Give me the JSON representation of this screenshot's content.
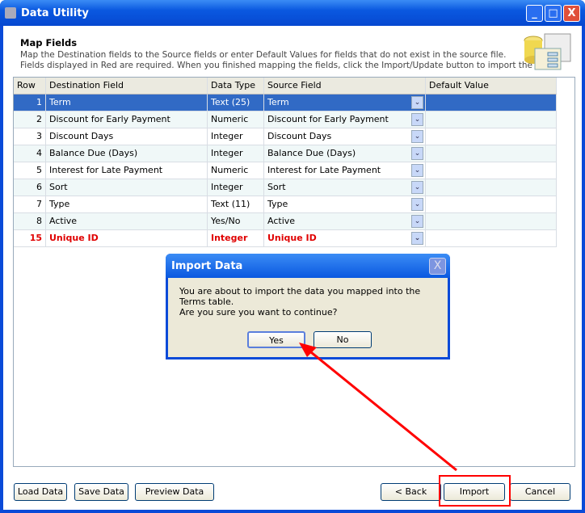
{
  "window": {
    "title": "Data Utility",
    "minimize": "_",
    "maximize": "□",
    "close": "X"
  },
  "header": {
    "title": "Map Fields",
    "line1": "Map the Destination fields to the Source fields or enter Default Values for fields that do not exist in the source file.",
    "line2": "Fields displayed in Red are required.  When you finished mapping the fields, click the Import/Update button to import the data."
  },
  "grid": {
    "columns": [
      "Row",
      "Destination Field",
      "Data Type",
      "Source Field",
      "Default Value"
    ],
    "rows": [
      {
        "row": "1",
        "dest": "Term",
        "type": "Text (25)",
        "source": "Term",
        "default": ""
      },
      {
        "row": "2",
        "dest": "Discount for Early Payment",
        "type": "Numeric",
        "source": "Discount for Early Payment",
        "default": ""
      },
      {
        "row": "3",
        "dest": "Discount Days",
        "type": "Integer",
        "source": "Discount Days",
        "default": ""
      },
      {
        "row": "4",
        "dest": "Balance Due (Days)",
        "type": "Integer",
        "source": "Balance Due (Days)",
        "default": ""
      },
      {
        "row": "5",
        "dest": "Interest for Late Payment",
        "type": "Numeric",
        "source": "Interest for Late Payment",
        "default": ""
      },
      {
        "row": "6",
        "dest": "Sort",
        "type": "Integer",
        "source": "Sort",
        "default": ""
      },
      {
        "row": "7",
        "dest": "Type",
        "type": "Text (11)",
        "source": "Type",
        "default": ""
      },
      {
        "row": "8",
        "dest": "Active",
        "type": "Yes/No",
        "source": "Active",
        "default": ""
      },
      {
        "row": "15",
        "dest": "Unique ID",
        "type": "Integer",
        "source": "Unique ID",
        "default": "",
        "required": true
      }
    ]
  },
  "buttons": {
    "load": "Load Data",
    "save": "Save Data",
    "preview": "Preview Data",
    "back": "< Back",
    "import": "Import",
    "cancel": "Cancel"
  },
  "dialog": {
    "title": "Import Data",
    "message": "You are about to import the data you mapped into the  Terms table.",
    "question": "Are you sure you want to continue?",
    "yes": "Yes",
    "no": "No",
    "close": "X"
  },
  "colors": {
    "highlight": "#ff0000",
    "selection": "#316ac5",
    "required": "#e00000"
  }
}
